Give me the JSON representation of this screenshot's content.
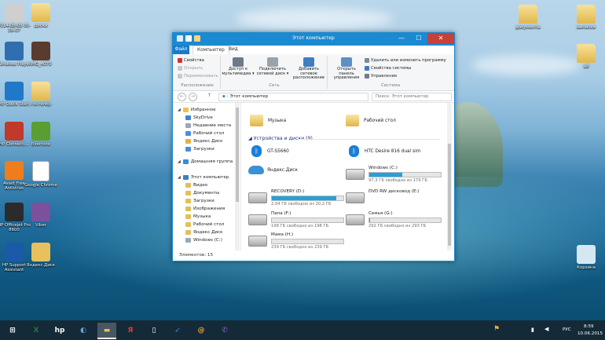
{
  "desktop": {
    "left_icons": [
      {
        "label": "2014-08-09 00-38-07",
        "icon": "image-icon",
        "color": "#cfcfcf"
      },
      {
        "label": "диски",
        "icon": "folder-icon",
        "color": "#e8c15c"
      },
      {
        "label": "Windows Player",
        "icon": "media-player-icon",
        "color": "#2f6fb0"
      },
      {
        "label": "IMG_4070",
        "icon": "photo-icon",
        "color": "#5a3b2e"
      },
      {
        "label": "HP Quick Start",
        "icon": "rocket-icon",
        "color": "#1f78c8"
      },
      {
        "label": "гостелер",
        "icon": "folder-icon",
        "color": "#e8c15c"
      },
      {
        "label": "HP Connecti...",
        "icon": "hp-icon",
        "color": "#c0392b"
      },
      {
        "label": "Evernote",
        "icon": "evernote-icon",
        "color": "#5a9e2f"
      },
      {
        "label": "Avast Free Antivirus",
        "icon": "avast-icon",
        "color": "#f07d1c"
      },
      {
        "label": "Google Chrome",
        "icon": "document-icon",
        "color": "#ffffff"
      },
      {
        "label": "HP Officejet Pro 8600",
        "icon": "printer-icon",
        "color": "#2b2b2b"
      },
      {
        "label": "Viber",
        "icon": "viber-icon",
        "color": "#7b519d"
      },
      {
        "label": "HP Support Assistant",
        "icon": "question-icon",
        "color": "#1a5aa8"
      },
      {
        "label": "Яндекс.Диск",
        "icon": "yandex-disk-icon",
        "color": "#e8c15c"
      }
    ],
    "right_icons": [
      {
        "label": "документы",
        "icon": "folder-icon",
        "color": "#e8c15c"
      },
      {
        "label": "выписки",
        "icon": "folder-icon",
        "color": "#e8c15c"
      },
      {
        "label": "аб",
        "icon": "folder-icon",
        "color": "#e8c15c"
      },
      {
        "label": "Корзина",
        "icon": "recycle-bin-icon",
        "color": "#d7e7f2"
      }
    ]
  },
  "window": {
    "title": "Этот компьютер",
    "controls": {
      "minimize": "—",
      "maximize": "☐",
      "close": "✕"
    },
    "tabs": {
      "file": "Файл",
      "computer": "Компьютер",
      "view": "Вид"
    },
    "ribbon": {
      "location": {
        "items": [
          {
            "label": "Свойства",
            "enabled": true
          },
          {
            "label": "Открыть",
            "enabled": false
          },
          {
            "label": "Переименовать",
            "enabled": false
          }
        ],
        "group_label": "Расположение"
      },
      "network": {
        "buttons": [
          {
            "label": "Доступ к мультимедиа ▾"
          },
          {
            "label": "Подключить сетевой диск ▾"
          },
          {
            "label": "Добавить сетевое расположение"
          }
        ],
        "group_label": "Сеть"
      },
      "system": {
        "open_panel": "Открыть панель управления",
        "items": [
          "Удалить или изменить программу",
          "Свойства системы",
          "Управление"
        ],
        "group_label": "Система"
      }
    },
    "address": {
      "path": "Этот компьютер",
      "search_placeholder": "Поиск: Этот компьютер"
    },
    "nav_pane": [
      {
        "label": "Избранное",
        "level": 0,
        "color": "#f0c24a"
      },
      {
        "label": "SkyDrive",
        "level": 1,
        "color": "#3b86d3"
      },
      {
        "label": "Недавние места",
        "level": 1,
        "color": "#9aa8b5"
      },
      {
        "label": "Рабочий стол",
        "level": 1,
        "color": "#4c8ed6"
      },
      {
        "label": "Яндекс.Диск",
        "level": 1,
        "color": "#e0b246"
      },
      {
        "label": "Загрузки",
        "level": 1,
        "color": "#4c8ed6"
      },
      {
        "label": "Домашняя группа",
        "level": 0,
        "color": "#2f8fd9"
      },
      {
        "label": "Этот компьютер",
        "level": 0,
        "color": "#3e7ec4"
      },
      {
        "label": "Видео",
        "level": 1,
        "color": "#e3bf5a"
      },
      {
        "label": "Документы",
        "level": 1,
        "color": "#e3bf5a"
      },
      {
        "label": "Загрузки",
        "level": 1,
        "color": "#e3bf5a"
      },
      {
        "label": "Изображения",
        "level": 1,
        "color": "#e3bf5a"
      },
      {
        "label": "Музыка",
        "level": 1,
        "color": "#e3bf5a"
      },
      {
        "label": "Рабочий стол",
        "level": 1,
        "color": "#e3bf5a"
      },
      {
        "label": "Яндекс.Диск",
        "level": 1,
        "color": "#e3bf5a"
      },
      {
        "label": "Windows (C:)",
        "level": 1,
        "color": "#9aa7b4"
      }
    ],
    "folders": [
      {
        "label": "Музыка"
      },
      {
        "label": "Рабочий стол"
      }
    ],
    "devices_header": "Устройства и диски (9)",
    "devices": [
      {
        "label": "GT-S5660",
        "icon": "bluetooth-icon"
      },
      {
        "label": "HTC Desire 816 dual sim",
        "icon": "bluetooth-icon"
      },
      {
        "label": "Яндекс.Диск",
        "icon": "cloud-icon"
      }
    ],
    "drives": [
      {
        "label": "Windows (C:)",
        "free": "97,3 ГБ свободно из 179 ГБ",
        "used_fraction": 0.46
      },
      {
        "label": "RECOVERY (D:)",
        "free": "2,04 ГБ свободно из 20,2 ГБ",
        "used_fraction": 0.9
      },
      {
        "label": "DVD RW дисковод (E:)",
        "free": "",
        "used_fraction": null
      },
      {
        "label": "Папа (F:)",
        "free": "198 ГБ свободно из 198 ГБ",
        "used_fraction": 0.0
      },
      {
        "label": "Семья (G:)",
        "free": "292 ГБ свободно из 293 ГБ",
        "used_fraction": 0.003
      },
      {
        "label": "Мама (H:)",
        "free": "239 ГБ свободно из 239 ГБ",
        "used_fraction": 0.0
      }
    ],
    "status": "Элементов: 15"
  },
  "taskbar": {
    "apps": [
      "windows-start-icon",
      "excel-icon",
      "hp-icon",
      "media-player-icon",
      "explorer-icon",
      "yandex-icon",
      "document-icon",
      "hp-quick-start-icon",
      "mail-icon",
      "viber-icon"
    ],
    "active_app": "explorer-icon",
    "language": "РУС",
    "time": "8:59",
    "date": "10.06.2015"
  }
}
